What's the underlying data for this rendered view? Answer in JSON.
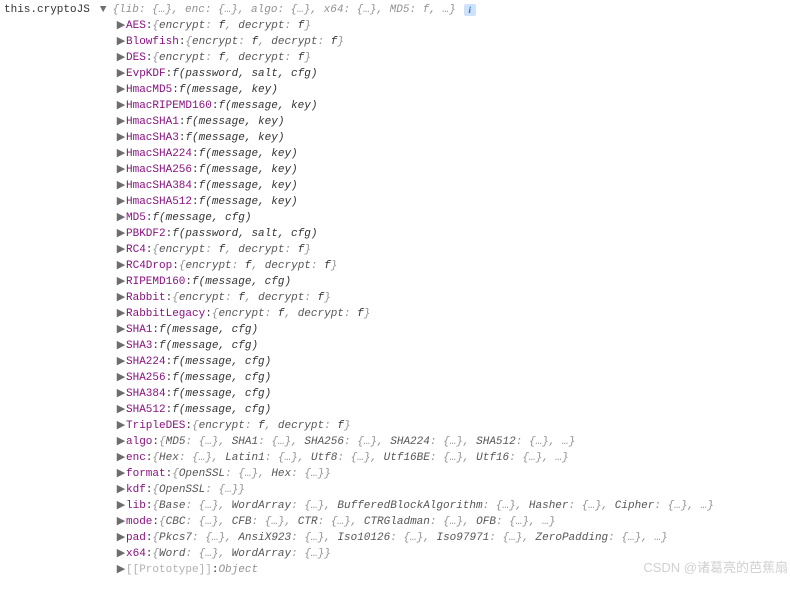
{
  "header": {
    "prefix": "this.cryptoJS",
    "toggle": "▼",
    "summary": "{lib: {…}, enc: {…}, algo: {…}, x64: {…}, MD5: f, …}",
    "info": "i"
  },
  "rows": [
    {
      "name": "AES",
      "preview": "{encrypt: f, decrypt: f}"
    },
    {
      "name": "Blowfish",
      "preview": "{encrypt: f, decrypt: f}"
    },
    {
      "name": "DES",
      "preview": "{encrypt: f, decrypt: f}"
    },
    {
      "name": "EvpKDF",
      "func": "f (password, salt, cfg)"
    },
    {
      "name": "HmacMD5",
      "func": "f (message, key)"
    },
    {
      "name": "HmacRIPEMD160",
      "func": "f (message, key)"
    },
    {
      "name": "HmacSHA1",
      "func": "f (message, key)"
    },
    {
      "name": "HmacSHA3",
      "func": "f (message, key)"
    },
    {
      "name": "HmacSHA224",
      "func": "f (message, key)"
    },
    {
      "name": "HmacSHA256",
      "func": "f (message, key)"
    },
    {
      "name": "HmacSHA384",
      "func": "f (message, key)"
    },
    {
      "name": "HmacSHA512",
      "func": "f (message, key)"
    },
    {
      "name": "MD5",
      "func": "f (message, cfg)"
    },
    {
      "name": "PBKDF2",
      "func": "f (password, salt, cfg)"
    },
    {
      "name": "RC4",
      "preview": "{encrypt: f, decrypt: f}"
    },
    {
      "name": "RC4Drop",
      "preview": "{encrypt: f, decrypt: f}"
    },
    {
      "name": "RIPEMD160",
      "func": "f (message, cfg)"
    },
    {
      "name": "Rabbit",
      "preview": "{encrypt: f, decrypt: f}"
    },
    {
      "name": "RabbitLegacy",
      "preview": "{encrypt: f, decrypt: f}"
    },
    {
      "name": "SHA1",
      "func": "f (message, cfg)"
    },
    {
      "name": "SHA3",
      "func": "f (message, cfg)"
    },
    {
      "name": "SHA224",
      "func": "f (message, cfg)"
    },
    {
      "name": "SHA256",
      "func": "f (message, cfg)"
    },
    {
      "name": "SHA384",
      "func": "f (message, cfg)"
    },
    {
      "name": "SHA512",
      "func": "f (message, cfg)"
    },
    {
      "name": "TripleDES",
      "preview": "{encrypt: f, decrypt: f}"
    },
    {
      "name": "algo",
      "preview": "{MD5: {…}, SHA1: {…}, SHA256: {…}, SHA224: {…}, SHA512: {…}, …}"
    },
    {
      "name": "enc",
      "preview": "{Hex: {…}, Latin1: {…}, Utf8: {…}, Utf16BE: {…}, Utf16: {…}, …}"
    },
    {
      "name": "format",
      "preview": "{OpenSSL: {…}, Hex: {…}}"
    },
    {
      "name": "kdf",
      "preview": "{OpenSSL: {…}}"
    },
    {
      "name": "lib",
      "preview": "{Base: {…}, WordArray: {…}, BufferedBlockAlgorithm: {…}, Hasher: {…}, Cipher: {…}, …}"
    },
    {
      "name": "mode",
      "preview": "{CBC: {…}, CFB: {…}, CTR: {…}, CTRGladman: {…}, OFB: {…}, …}"
    },
    {
      "name": "pad",
      "preview": "{Pkcs7: {…}, AnsiX923: {…}, Iso10126: {…}, Iso97971: {…}, ZeroPadding: {…}, …}"
    },
    {
      "name": "x64",
      "preview": "{Word: {…}, WordArray: {…}}"
    },
    {
      "name": "[[Prototype]]",
      "plain": "Object",
      "dim": true
    }
  ],
  "watermark": "CSDN @诸葛亮的芭蕉扇"
}
